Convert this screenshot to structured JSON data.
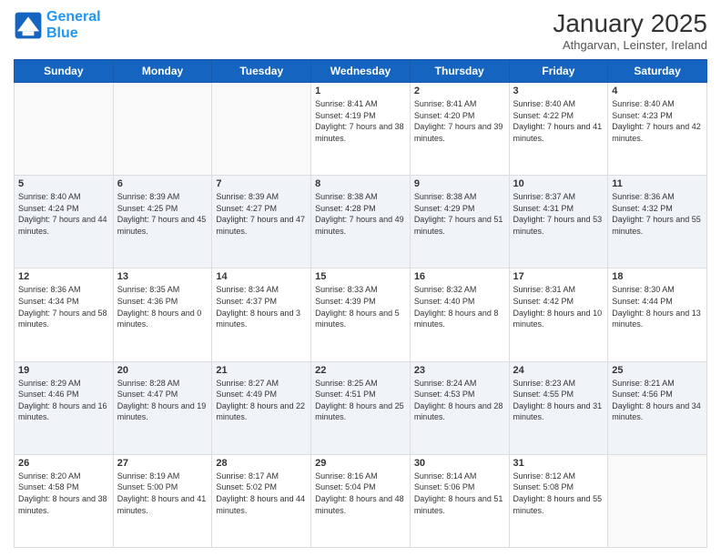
{
  "header": {
    "logo_line1": "General",
    "logo_line2": "Blue",
    "month_title": "January 2025",
    "location": "Athgarvan, Leinster, Ireland"
  },
  "weekdays": [
    "Sunday",
    "Monday",
    "Tuesday",
    "Wednesday",
    "Thursday",
    "Friday",
    "Saturday"
  ],
  "weeks": [
    [
      {
        "day": "",
        "sunrise": "",
        "sunset": "",
        "daylight": ""
      },
      {
        "day": "",
        "sunrise": "",
        "sunset": "",
        "daylight": ""
      },
      {
        "day": "",
        "sunrise": "",
        "sunset": "",
        "daylight": ""
      },
      {
        "day": "1",
        "sunrise": "Sunrise: 8:41 AM",
        "sunset": "Sunset: 4:19 PM",
        "daylight": "Daylight: 7 hours and 38 minutes."
      },
      {
        "day": "2",
        "sunrise": "Sunrise: 8:41 AM",
        "sunset": "Sunset: 4:20 PM",
        "daylight": "Daylight: 7 hours and 39 minutes."
      },
      {
        "day": "3",
        "sunrise": "Sunrise: 8:40 AM",
        "sunset": "Sunset: 4:22 PM",
        "daylight": "Daylight: 7 hours and 41 minutes."
      },
      {
        "day": "4",
        "sunrise": "Sunrise: 8:40 AM",
        "sunset": "Sunset: 4:23 PM",
        "daylight": "Daylight: 7 hours and 42 minutes."
      }
    ],
    [
      {
        "day": "5",
        "sunrise": "Sunrise: 8:40 AM",
        "sunset": "Sunset: 4:24 PM",
        "daylight": "Daylight: 7 hours and 44 minutes."
      },
      {
        "day": "6",
        "sunrise": "Sunrise: 8:39 AM",
        "sunset": "Sunset: 4:25 PM",
        "daylight": "Daylight: 7 hours and 45 minutes."
      },
      {
        "day": "7",
        "sunrise": "Sunrise: 8:39 AM",
        "sunset": "Sunset: 4:27 PM",
        "daylight": "Daylight: 7 hours and 47 minutes."
      },
      {
        "day": "8",
        "sunrise": "Sunrise: 8:38 AM",
        "sunset": "Sunset: 4:28 PM",
        "daylight": "Daylight: 7 hours and 49 minutes."
      },
      {
        "day": "9",
        "sunrise": "Sunrise: 8:38 AM",
        "sunset": "Sunset: 4:29 PM",
        "daylight": "Daylight: 7 hours and 51 minutes."
      },
      {
        "day": "10",
        "sunrise": "Sunrise: 8:37 AM",
        "sunset": "Sunset: 4:31 PM",
        "daylight": "Daylight: 7 hours and 53 minutes."
      },
      {
        "day": "11",
        "sunrise": "Sunrise: 8:36 AM",
        "sunset": "Sunset: 4:32 PM",
        "daylight": "Daylight: 7 hours and 55 minutes."
      }
    ],
    [
      {
        "day": "12",
        "sunrise": "Sunrise: 8:36 AM",
        "sunset": "Sunset: 4:34 PM",
        "daylight": "Daylight: 7 hours and 58 minutes."
      },
      {
        "day": "13",
        "sunrise": "Sunrise: 8:35 AM",
        "sunset": "Sunset: 4:36 PM",
        "daylight": "Daylight: 8 hours and 0 minutes."
      },
      {
        "day": "14",
        "sunrise": "Sunrise: 8:34 AM",
        "sunset": "Sunset: 4:37 PM",
        "daylight": "Daylight: 8 hours and 3 minutes."
      },
      {
        "day": "15",
        "sunrise": "Sunrise: 8:33 AM",
        "sunset": "Sunset: 4:39 PM",
        "daylight": "Daylight: 8 hours and 5 minutes."
      },
      {
        "day": "16",
        "sunrise": "Sunrise: 8:32 AM",
        "sunset": "Sunset: 4:40 PM",
        "daylight": "Daylight: 8 hours and 8 minutes."
      },
      {
        "day": "17",
        "sunrise": "Sunrise: 8:31 AM",
        "sunset": "Sunset: 4:42 PM",
        "daylight": "Daylight: 8 hours and 10 minutes."
      },
      {
        "day": "18",
        "sunrise": "Sunrise: 8:30 AM",
        "sunset": "Sunset: 4:44 PM",
        "daylight": "Daylight: 8 hours and 13 minutes."
      }
    ],
    [
      {
        "day": "19",
        "sunrise": "Sunrise: 8:29 AM",
        "sunset": "Sunset: 4:46 PM",
        "daylight": "Daylight: 8 hours and 16 minutes."
      },
      {
        "day": "20",
        "sunrise": "Sunrise: 8:28 AM",
        "sunset": "Sunset: 4:47 PM",
        "daylight": "Daylight: 8 hours and 19 minutes."
      },
      {
        "day": "21",
        "sunrise": "Sunrise: 8:27 AM",
        "sunset": "Sunset: 4:49 PM",
        "daylight": "Daylight: 8 hours and 22 minutes."
      },
      {
        "day": "22",
        "sunrise": "Sunrise: 8:25 AM",
        "sunset": "Sunset: 4:51 PM",
        "daylight": "Daylight: 8 hours and 25 minutes."
      },
      {
        "day": "23",
        "sunrise": "Sunrise: 8:24 AM",
        "sunset": "Sunset: 4:53 PM",
        "daylight": "Daylight: 8 hours and 28 minutes."
      },
      {
        "day": "24",
        "sunrise": "Sunrise: 8:23 AM",
        "sunset": "Sunset: 4:55 PM",
        "daylight": "Daylight: 8 hours and 31 minutes."
      },
      {
        "day": "25",
        "sunrise": "Sunrise: 8:21 AM",
        "sunset": "Sunset: 4:56 PM",
        "daylight": "Daylight: 8 hours and 34 minutes."
      }
    ],
    [
      {
        "day": "26",
        "sunrise": "Sunrise: 8:20 AM",
        "sunset": "Sunset: 4:58 PM",
        "daylight": "Daylight: 8 hours and 38 minutes."
      },
      {
        "day": "27",
        "sunrise": "Sunrise: 8:19 AM",
        "sunset": "Sunset: 5:00 PM",
        "daylight": "Daylight: 8 hours and 41 minutes."
      },
      {
        "day": "28",
        "sunrise": "Sunrise: 8:17 AM",
        "sunset": "Sunset: 5:02 PM",
        "daylight": "Daylight: 8 hours and 44 minutes."
      },
      {
        "day": "29",
        "sunrise": "Sunrise: 8:16 AM",
        "sunset": "Sunset: 5:04 PM",
        "daylight": "Daylight: 8 hours and 48 minutes."
      },
      {
        "day": "30",
        "sunrise": "Sunrise: 8:14 AM",
        "sunset": "Sunset: 5:06 PM",
        "daylight": "Daylight: 8 hours and 51 minutes."
      },
      {
        "day": "31",
        "sunrise": "Sunrise: 8:12 AM",
        "sunset": "Sunset: 5:08 PM",
        "daylight": "Daylight: 8 hours and 55 minutes."
      },
      {
        "day": "",
        "sunrise": "",
        "sunset": "",
        "daylight": ""
      }
    ]
  ]
}
